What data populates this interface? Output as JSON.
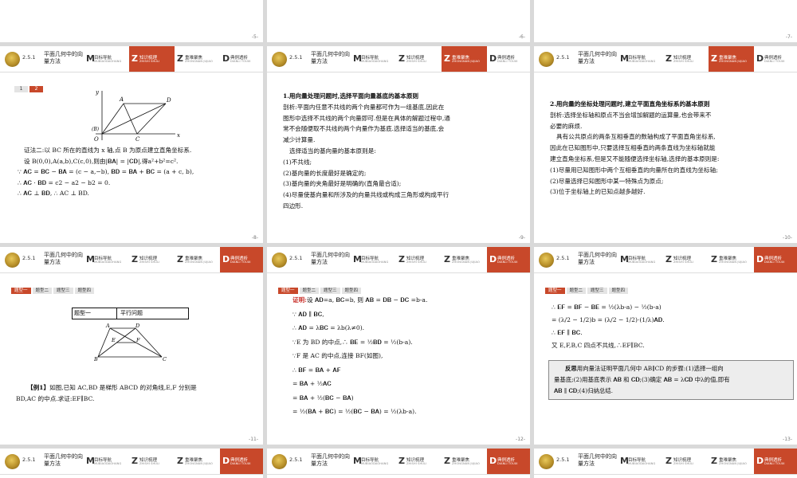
{
  "header": {
    "section": "2.5.1",
    "title": "平面几何中的向量方法",
    "tabs": [
      {
        "letter": "M",
        "label": "目标导航",
        "pinyin": "MUBIAODAOHANG"
      },
      {
        "letter": "Z",
        "label": "知识梳理",
        "pinyin": "ZHISHI SHULI"
      },
      {
        "letter": "Z",
        "label": "重难聚焦",
        "pinyin": "ZHONGNAN JUJIAO"
      },
      {
        "letter": "D",
        "label": "典例透析",
        "pinyin": "DIANLI TOUXI"
      }
    ]
  },
  "top_page_numbers": [
    "-5-",
    "-6-",
    "-7-"
  ],
  "slide8": {
    "page": "-8-",
    "pager": [
      "1",
      "2"
    ],
    "lines": [
      "证法二:以 BC 所在的直线为 x 轴,点 B 为原点建立直角坐标系.",
      "设 B(0,0),A(a,b),C(c,0),则由|𝐁𝐀| = |𝐂𝐃|,得a²+b²=c².",
      "∵ 𝐀𝐂 = 𝐁𝐂 − 𝐁𝐀 = (c − a,−b), 𝐁𝐃 = 𝐁𝐀 + 𝐁𝐂 = (a + c, b),",
      "∴ 𝐀𝐂 · 𝐁𝐃 = c2 − a2 − b2 = 0.",
      "∴ 𝐀𝐂 ⊥ 𝐁𝐃, ∴ AC ⊥ BD."
    ],
    "figure_labels": {
      "y": "y",
      "x": "x",
      "A": "A",
      "D": "D",
      "B": "(B)",
      "O": "O",
      "C": "C"
    }
  },
  "slide9": {
    "page": "-9-",
    "heading": "1.用向量处理问题时,选择平面向量基底的基本原则",
    "lines": [
      "剖析:平面内任意不共线的两个向量都可作为一组基底,因此在",
      "图形中选择不共线的两个向量即可.但是在具体的解题过程中,通",
      "常不会随便取不共线的两个向量作为基底.选择适当的基底,会",
      "减少计算量.",
      "选择适当的基向量的基本原则是:",
      "(1)不共线;",
      "(2)基向量的长度最好是确定的;",
      "(3)基向量的夹角最好是明确的(直角最合适);",
      "(4)尽量使基向量和所涉及的向量共线或构成三角形或构成平行",
      "四边形."
    ]
  },
  "slide10": {
    "page": "-10-",
    "heading": "2.用向量的坐标处理问题时,建立平面直角坐标系的基本原则",
    "lines": [
      "剖析:选择坐标轴和原点不当会增加解题的运算量,也会带来不",
      "必要的麻烦.",
      "具有公共原点的两条互相垂直的数轴构成了平面直角坐标系,",
      "因此在已知图形中,只要选择互相垂直的两条直线为坐标轴就能",
      "建立直角坐标系,但是又不能随便选择坐标轴,选择的基本原则是:",
      "(1)尽量用已知图形中两个互相垂直的向量所在的直线为坐标轴;",
      "(2)尽量选择已知图形中某一特殊点为原点;",
      "(3)位于坐标轴上的已知点越多越好."
    ]
  },
  "qtabs": [
    "题型一",
    "题型二",
    "题型三",
    "题型四"
  ],
  "slide11": {
    "page": "-11-",
    "table_cells": [
      "题型一",
      "平行问题"
    ],
    "example_label": "【例1】",
    "lines": [
      "如图,已知 AC,BD 是梯形 ABCD 的对角线,E,F 分别是",
      "BD,AC 的中点.求证:EF∥BC."
    ],
    "figure_labels": {
      "A": "A",
      "D": "D",
      "E": "E",
      "F": "F",
      "B": "B",
      "C": "C"
    }
  },
  "slide12": {
    "page": "-12-",
    "proof_label": "证明:",
    "lines": [
      "设 𝐀𝐃=a, 𝐁𝐂=b, 则 𝐀𝐁 = 𝐃𝐁 − 𝐃𝐂 =b-a.",
      "∵ 𝐀𝐃 ∥ 𝐁𝐂,",
      "∴ 𝐀𝐃 = λ𝐁𝐂 = λb(λ≠0).",
      "∵E 为 BD 的中点,∴ 𝐁𝐄 = ½𝐁𝐃 = ½(b-a).",
      "∵F 是 AC 的中点,连接 BF(如图),",
      "∴ 𝐁𝐅 = 𝐁𝐀 + 𝐀𝐅",
      "= 𝐁𝐀 + ½𝐀𝐂",
      "= 𝐁𝐀 + ½(𝐁𝐂 − 𝐁𝐀)",
      "= ½(𝐁𝐀 + 𝐁𝐂) = ½(𝐁𝐂 − 𝐁𝐀) = ½(λb-a)."
    ]
  },
  "slide13": {
    "page": "-13-",
    "lines": [
      "∴ 𝐄𝐅 = 𝐁𝐅 − 𝐁𝐄 = ½(λb-a) − ½(b-a)",
      "= (λ/2 − 1/2)b = (λ/2 − 1/2)·(1/λ)𝐀𝐃.",
      "∴ 𝐄𝐅 ∥ 𝐁𝐂.",
      "又 E,F,B,C 四点不共线,∴EF∥BC."
    ],
    "reflect_label": "反思",
    "reflect_lines": [
      "用向量法证明平面几何中 AB∥CD 的步骤:(1)选择一组向",
      "量基底;(2)用基底表示 𝐀𝐁 和 𝐂𝐃;(3)确定 𝐀𝐁 = λ𝐂𝐃 中λ的值,即有",
      "𝐀𝐁 ∥ 𝐂𝐃;(4)归纳总结."
    ]
  }
}
